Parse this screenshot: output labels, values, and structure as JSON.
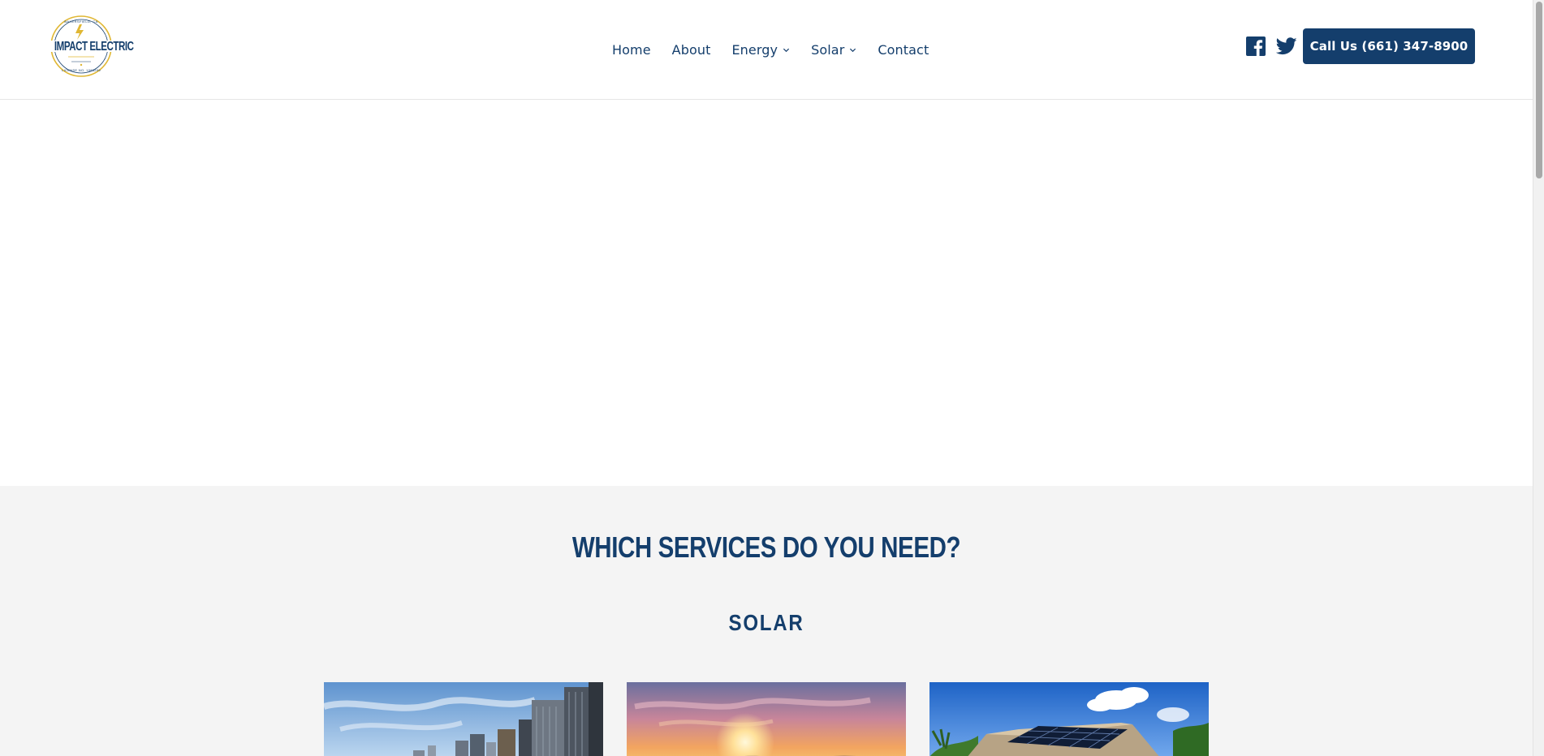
{
  "header": {
    "logo_text": "IMPACT ELECTRIC",
    "logo_arc_top": "BAKERSFIELD, CA",
    "logo_arc_bottom": "LICENSE NO. 1083299",
    "nav": [
      {
        "label": "Home",
        "has_dropdown": false
      },
      {
        "label": "About",
        "has_dropdown": false
      },
      {
        "label": "Energy",
        "has_dropdown": true
      },
      {
        "label": "Solar",
        "has_dropdown": true
      },
      {
        "label": "Contact",
        "has_dropdown": false
      }
    ],
    "social": [
      "facebook-icon",
      "twitter-icon"
    ],
    "call_button": "Call Us (661) 347-8900"
  },
  "services": {
    "title": "WHICH SERVICES DO YOU NEED?",
    "section": "SOLAR",
    "cards": [
      {
        "image": "city-skyline-photo"
      },
      {
        "image": "sunset-photo"
      },
      {
        "image": "rooftop-solar-panels-photo"
      }
    ]
  },
  "colors": {
    "brand_navy": "#143e6c",
    "gold": "#e0b733",
    "section_bg": "#f4f4f4"
  }
}
